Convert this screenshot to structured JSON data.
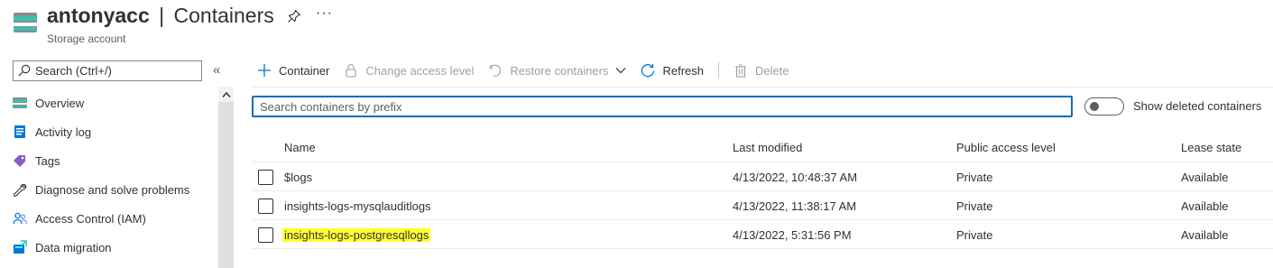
{
  "header": {
    "account": "antonyacc",
    "separator": "|",
    "page": "Containers",
    "subtitle": "Storage account",
    "more": "···"
  },
  "sidebar": {
    "search_placeholder": "Search (Ctrl+/)",
    "collapse": "«",
    "items": [
      {
        "label": "Overview",
        "icon": "storage-overview-icon"
      },
      {
        "label": "Activity log",
        "icon": "activity-log-icon"
      },
      {
        "label": "Tags",
        "icon": "tag-icon"
      },
      {
        "label": "Diagnose and solve problems",
        "icon": "wrench-icon"
      },
      {
        "label": "Access Control (IAM)",
        "icon": "people-icon"
      },
      {
        "label": "Data migration",
        "icon": "data-migration-icon"
      }
    ]
  },
  "toolbar": {
    "container": "Container",
    "change_access": "Change access level",
    "restore": "Restore containers",
    "refresh": "Refresh",
    "delete": "Delete"
  },
  "filter": {
    "placeholder": "Search containers by prefix",
    "toggle_label": "Show deleted containers",
    "toggle_on": false
  },
  "table": {
    "headers": {
      "name": "Name",
      "modified": "Last modified",
      "public": "Public access level",
      "lease": "Lease state"
    },
    "rows": [
      {
        "name": "$logs",
        "modified": "4/13/2022, 10:48:37 AM",
        "public": "Private",
        "lease": "Available",
        "highlighted": false
      },
      {
        "name": "insights-logs-mysqlauditlogs",
        "modified": "4/13/2022, 11:38:17 AM",
        "public": "Private",
        "lease": "Available",
        "highlighted": false
      },
      {
        "name": "insights-logs-postgresqllogs",
        "modified": "4/13/2022, 5:31:56 PM",
        "public": "Private",
        "lease": "Available",
        "highlighted": true
      }
    ]
  },
  "colors": {
    "accent": "#0f6cbd",
    "highlight": "#ffff33",
    "disabled_text": "#a19f9d"
  }
}
